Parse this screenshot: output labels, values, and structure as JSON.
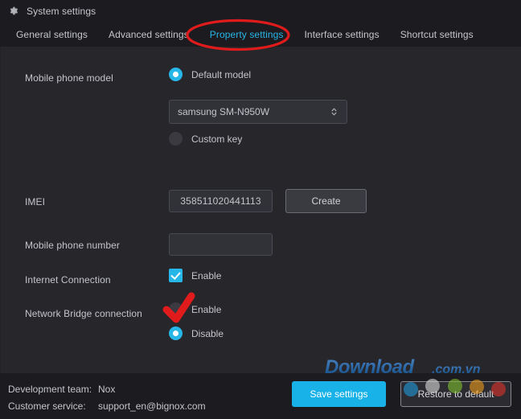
{
  "window": {
    "title": "System settings",
    "icon": "gear-icon"
  },
  "tabs": [
    {
      "label": "General settings",
      "active": false
    },
    {
      "label": "Advanced settings",
      "active": false
    },
    {
      "label": "Property settings",
      "active": true
    },
    {
      "label": "Interface settings",
      "active": false
    },
    {
      "label": "Shortcut settings",
      "active": false
    }
  ],
  "form": {
    "phone_model": {
      "label": "Mobile phone model",
      "option_default": "Default model",
      "option_custom": "Custom key",
      "selected": "default",
      "model_select_value": "samsung SM-N950W"
    },
    "imei": {
      "label": "IMEI",
      "value": "358511020441113",
      "create_button": "Create"
    },
    "phone_number": {
      "label": "Mobile phone number",
      "value": "",
      "placeholder": ""
    },
    "internet_connection": {
      "label": "Internet Connection",
      "enable_label": "Enable",
      "checked": true
    },
    "network_bridge": {
      "label": "Network Bridge connection",
      "enable_label": "Enable",
      "disable_label": "Disable",
      "selected": "disable"
    }
  },
  "footer": {
    "dev_team_key": "Development team:",
    "dev_team_value": "Nox",
    "support_key": "Customer service:",
    "support_value": "support_en@bignox.com",
    "save_button": "Save settings",
    "restore_button": "Restore to default"
  },
  "annotations": {
    "ellipse_target": "Property settings",
    "check_target": "Network Bridge connection Enable",
    "color": "#e01b1b"
  },
  "watermark": {
    "text_main": "Download",
    "text_suffix": ".com.vn"
  },
  "colors": {
    "accent": "#27b6e8",
    "save_button": "#18b2e8",
    "panel": "#26262b",
    "chrome": "#1c1c20",
    "annotation_red": "#e01b1b"
  }
}
